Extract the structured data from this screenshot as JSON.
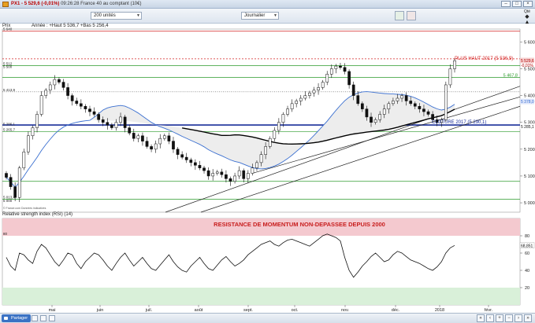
{
  "window": {
    "title_symbol": "PX1",
    "title_price": "5 529,6 (-0,01%)",
    "title_rest": "09:26:28 France 40 au comptant (10€)"
  },
  "toolbar": {
    "units_select": "200 unités",
    "period_select": "Journalier",
    "zoom_label": "Qté"
  },
  "status": {
    "share_label": "Partager"
  },
  "legend": {
    "price_label": "Prix",
    "year_label": "Année : +Haut 5 536,7 +Bas 5 256,4",
    "source": "© France.com Données indicatives"
  },
  "rsi": {
    "label": "Relative strength index (RSI) (14)",
    "current_value": "68,851"
  },
  "annotations": {
    "high_label": "PLUS HAUT 2017 (5 536,9)",
    "close_label": "CLOTURE 2017 (5 290,1)",
    "momentum_label": "RESISTANCE DE MOMENTUM NON-DEPASSEE DEPUIS 2000",
    "price_tag": "5 529,6",
    "pct_tag": "-0,01%",
    "level_5467": "5 467,8",
    "ma_tag": "5 378,0",
    "close_tag": "5 285,1"
  },
  "colors": {
    "up": "#ffffff",
    "down": "#111111",
    "ma_blue": "#3a6fd0",
    "ma_black": "#000000",
    "red_dash": "#d42020",
    "green_level": "#2a9a2a",
    "navy_level": "#1a2f9a",
    "resistance_fill": "#f4c9cf",
    "support_fill": "#d9f0d9"
  },
  "chart_data": [
    {
      "type": "candlestick",
      "title": "",
      "y_axis": {
        "ticks": [
          5000,
          5100,
          5200,
          5300,
          5400,
          5500,
          5600
        ],
        "ylim": [
          4965,
          5648
        ]
      },
      "x_axis": {
        "ticks": [
          "mai",
          "juin",
          "juil.",
          "août",
          "sept.",
          "oct.",
          "nov.",
          "déc.",
          "2018",
          "févr."
        ]
      },
      "left_levels": [
        "5 640",
        "5 512",
        "5 500",
        "5 413,9",
        "5 286,1",
        "5 265,7",
        "5 000",
        "5 013,4"
      ],
      "closes": [
        5095,
        5060,
        5020,
        5130,
        5190,
        5250,
        5280,
        5330,
        5400,
        5420,
        5440,
        5460,
        5450,
        5430,
        5400,
        5380,
        5370,
        5360,
        5350,
        5340,
        5330,
        5310,
        5300,
        5290,
        5280,
        5300,
        5320,
        5280,
        5260,
        5240,
        5250,
        5230,
        5210,
        5200,
        5220,
        5240,
        5250,
        5230,
        5200,
        5180,
        5170,
        5160,
        5150,
        5140,
        5130,
        5120,
        5100,
        5110,
        5115,
        5105,
        5090,
        5080,
        5100,
        5120,
        5090,
        5110,
        5130,
        5150,
        5180,
        5210,
        5240,
        5270,
        5300,
        5330,
        5350,
        5370,
        5380,
        5390,
        5400,
        5410,
        5420,
        5430,
        5450,
        5480,
        5500,
        5510,
        5505,
        5490,
        5440,
        5400,
        5370,
        5350,
        5320,
        5300,
        5310,
        5330,
        5350,
        5370,
        5380,
        5390,
        5400,
        5380,
        5370,
        5360,
        5350,
        5340,
        5330,
        5310,
        5300,
        5310,
        5440,
        5500,
        5530
      ],
      "horizontal_levels": {
        "high_2017": 5536.9,
        "level_green": 5467.8,
        "ma_level": 5378.0,
        "close_2017": 5290.1,
        "close_tag": 5285.1
      }
    },
    {
      "type": "line",
      "title": "Relative strength index (RSI) (14)",
      "y_axis": {
        "ticks": [
          80,
          60,
          40,
          20
        ],
        "ylim": [
          0,
          100
        ]
      },
      "zones": {
        "resistance_above": 80,
        "support_below": 20
      },
      "values": [
        55,
        45,
        40,
        60,
        58,
        52,
        48,
        62,
        70,
        66,
        58,
        50,
        45,
        52,
        60,
        58,
        48,
        42,
        50,
        55,
        60,
        58,
        52,
        45,
        40,
        48,
        55,
        60,
        52,
        45,
        50,
        55,
        48,
        42,
        40,
        46,
        52,
        58,
        50,
        44,
        40,
        38,
        45,
        50,
        55,
        48,
        42,
        40,
        46,
        52,
        56,
        50,
        45,
        48,
        52,
        58,
        62,
        66,
        70,
        72,
        74,
        70,
        68,
        72,
        75,
        76,
        74,
        72,
        70,
        68,
        72,
        76,
        80,
        82,
        80,
        78,
        74,
        55,
        40,
        32,
        38,
        45,
        50,
        56,
        60,
        55,
        50,
        52,
        58,
        62,
        60,
        56,
        52,
        50,
        48,
        45,
        42,
        40,
        44,
        50,
        60,
        66,
        68.851
      ]
    }
  ]
}
